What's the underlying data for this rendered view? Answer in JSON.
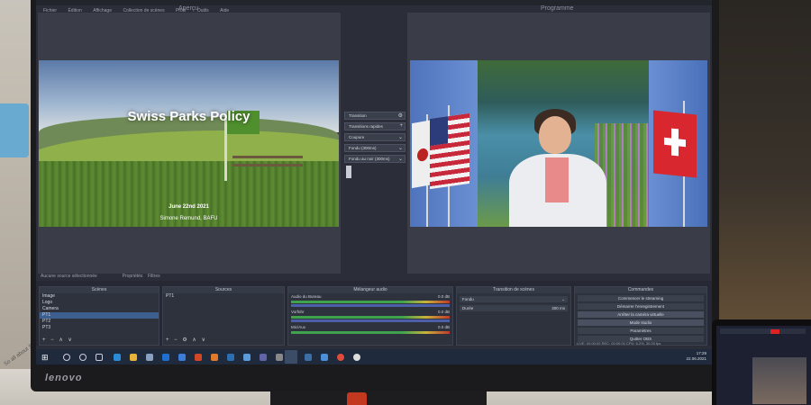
{
  "menubar": {
    "items": [
      "Fichier",
      "Édition",
      "Affichage",
      "Collection de scènes",
      "Profil",
      "Outils",
      "Aide"
    ]
  },
  "preview": {
    "title": "Aperçu",
    "slide": {
      "title": "Swiss Parks Policy",
      "date": "June 22nd 2021",
      "author": "Simone Remund, BAFU"
    }
  },
  "program": {
    "title": "Programme"
  },
  "transition_panel": {
    "items": [
      "Transition",
      "Transitions rapides",
      "Coupure",
      "Fondu (300ms)",
      "Fondu au noir (300ms)"
    ],
    "indicators": [
      "⚙",
      "+",
      "⌄",
      "⌄",
      "⌄"
    ]
  },
  "docks": {
    "no_source": "Aucune source sélectionnée",
    "props_label": "Propriétés",
    "filters_label": "Filtres",
    "scenes": {
      "title": "Scènes",
      "items": [
        "Image",
        "Logo",
        "Camera",
        "PT1",
        "PT2",
        "PT3"
      ],
      "tools": "+ − ∧ ∨"
    },
    "sources": {
      "title": "Sources",
      "items": [
        "PT1"
      ],
      "tools": "+ − ⚙ ∧ ∨"
    },
    "mixer": {
      "title": "Mélangeur audio",
      "channels": [
        {
          "name": "Audio du Bureau",
          "db": "0.0 dB"
        },
        {
          "name": "Vorführ",
          "db": "0.0 dB"
        },
        {
          "name": "Mic/Aux",
          "db": "0.0 dB"
        }
      ]
    },
    "scene_transitions": {
      "title": "Transition de scènes",
      "selected": "Fondu",
      "duration_label": "Durée",
      "duration_value": "300 ms"
    },
    "controls": {
      "title": "Commandes",
      "buttons": [
        "Commencer le streaming",
        "Démarrer l'enregistrement",
        "Arrêter la caméra virtuelle",
        "Mode studio",
        "Paramètres",
        "Quitter OBS"
      ]
    }
  },
  "statusbar": {
    "text": "LIVE: 00:00:00   REC: 00:00:00   CPU: 6.2%, 30.00 fps"
  },
  "taskbar": {
    "time": "17:29",
    "date": "22.06.2021"
  },
  "bezel": {
    "brand": "lenovo"
  },
  "environment": {
    "paper_text": "So all about S"
  },
  "colors": {
    "obs_bg": "#2b2e38",
    "taskbar": "#1f2a3c",
    "accent": "#3c5f8f"
  }
}
